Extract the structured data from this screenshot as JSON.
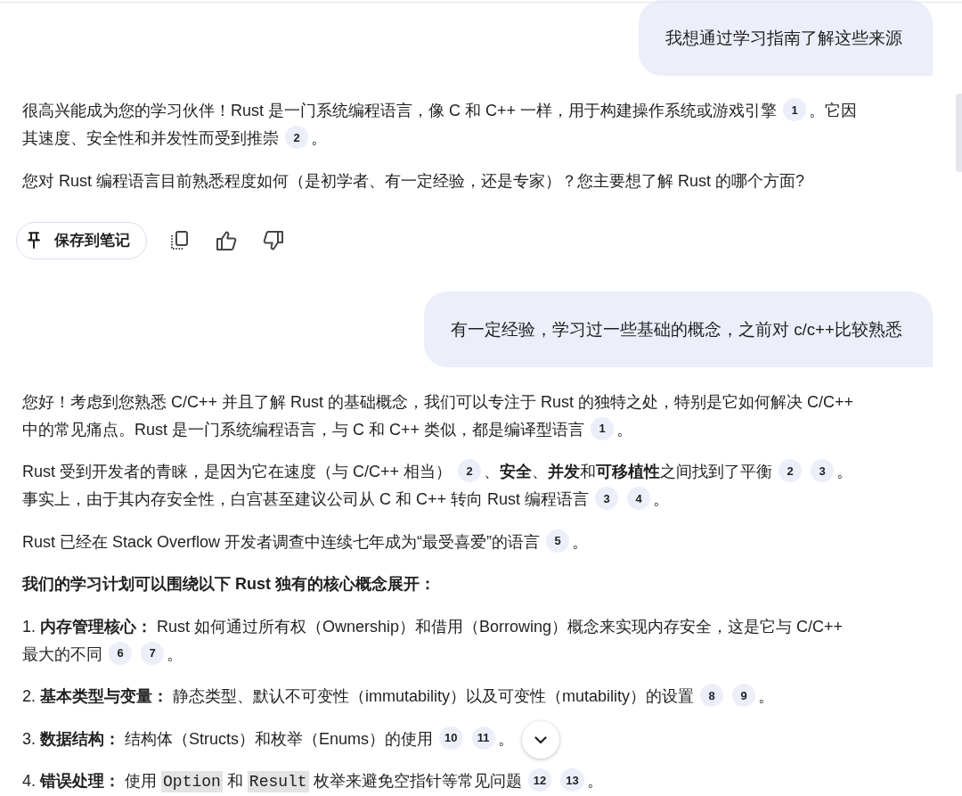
{
  "messages": [
    {
      "kind": "user",
      "text": "我想通过学习指南了解这些来源"
    },
    {
      "kind": "assistant",
      "paragraphs": [
        {
          "kind": "text",
          "parts": [
            {
              "kind": "text",
              "text": "很高兴能成为您的学习伙伴！Rust 是一门系统编程语言，像 C 和 C++ 一样，用于构建操作系统或游戏引擎"
            },
            {
              "kind": "cite",
              "text": "1"
            },
            {
              "kind": "text",
              "text": "。它因其速度、安全性和并发性而受到推崇"
            },
            {
              "kind": "cite",
              "text": "2"
            },
            {
              "kind": "text",
              "text": "。"
            }
          ]
        },
        {
          "kind": "text",
          "parts": [
            {
              "kind": "text",
              "text": "您对 Rust 编程语言目前熟悉程度如何（是初学者、有一定经验，还是专家）？您主要想了解 Rust 的哪个方面?"
            }
          ]
        }
      ],
      "note_button": {
        "label": "保存到笔记"
      }
    },
    {
      "kind": "user",
      "text": "有一定经验，学习过一些基础的概念，之前对 c/c++比较熟悉"
    },
    {
      "kind": "assistant",
      "paragraphs": [
        {
          "kind": "text",
          "parts": [
            {
              "kind": "text",
              "text": "您好！考虑到您熟悉 C/C++ 并且了解 Rust 的基础概念，我们可以专注于 Rust 的独特之处，特别是它如何解决 C/C++ 中的常见痛点。Rust 是一门系统编程语言，与 C 和 C++ 类似，都是编译型语言"
            },
            {
              "kind": "cite",
              "text": "1"
            },
            {
              "kind": "text",
              "text": "。"
            }
          ]
        },
        {
          "kind": "text",
          "parts": [
            {
              "kind": "text",
              "text": "Rust 受到开发者的青睐，是因为它在速度（与 C/C++ 相当）"
            },
            {
              "kind": "cite",
              "text": "2"
            },
            {
              "kind": "text",
              "text": "、**安全**、**并发**和**可移植性**之间找到了平衡"
            },
            {
              "kind": "cite",
              "text": "2"
            },
            {
              "kind": "cite",
              "text": "3"
            },
            {
              "kind": "text",
              "text": "。事实上，由于其内存安全性，白宫甚至建议公司从 C 和 C++ 转向 Rust 编程语言"
            },
            {
              "kind": "cite",
              "text": "3"
            },
            {
              "kind": "cite",
              "text": "4"
            },
            {
              "kind": "text",
              "text": "。"
            }
          ]
        },
        {
          "kind": "text",
          "parts": [
            {
              "kind": "text",
              "text": "Rust 已经在 Stack Overflow 开发者调查中连续七年成为“最受喜爱”的语言"
            },
            {
              "kind": "cite",
              "text": "5"
            },
            {
              "kind": "text",
              "text": "。"
            }
          ]
        },
        {
          "kind": "heading",
          "parts": [
            {
              "kind": "text",
              "text": "我们的学习计划可以围绕以下 Rust 独有的核心概念展开："
            }
          ]
        },
        {
          "kind": "text",
          "parts": [
            {
              "kind": "text",
              "text": "1. **内存管理核心：** Rust 如何通过所有权（Ownership）和借用（Borrowing）概念来实现内存安全，这是它与 C/C++ 最大的不同"
            },
            {
              "kind": "cite",
              "text": "6"
            },
            {
              "kind": "cite",
              "text": "7"
            },
            {
              "kind": "text",
              "text": "。"
            }
          ]
        },
        {
          "kind": "text",
          "parts": [
            {
              "kind": "text",
              "text": "2. **基本类型与变量：** 静态类型、默认不可变性（immutability）以及可变性（mutability）的设置"
            },
            {
              "kind": "cite",
              "text": "8"
            },
            {
              "kind": "cite",
              "text": "9"
            },
            {
              "kind": "text",
              "text": "。"
            }
          ]
        },
        {
          "kind": "text",
          "parts": [
            {
              "kind": "text",
              "text": "3. **数据结构：** 结构体（Structs）和枚举（Enums）的使用"
            },
            {
              "kind": "cite",
              "text": "10"
            },
            {
              "kind": "cite",
              "text": "11"
            },
            {
              "kind": "text",
              "text": "。"
            }
          ]
        },
        {
          "kind": "text",
          "parts": [
            {
              "kind": "text",
              "text": "4. **错误处理：** 使用 "
            },
            {
              "kind": "code",
              "text": "Option"
            },
            {
              "kind": "text",
              "text": " 和 "
            },
            {
              "kind": "code",
              "text": "Result"
            },
            {
              "kind": "text",
              "text": " 枚举来避免空指针等常见问题"
            },
            {
              "kind": "cite",
              "text": "12"
            },
            {
              "kind": "cite",
              "text": "13"
            },
            {
              "kind": "text",
              "text": "。"
            }
          ]
        }
      ]
    }
  ]
}
